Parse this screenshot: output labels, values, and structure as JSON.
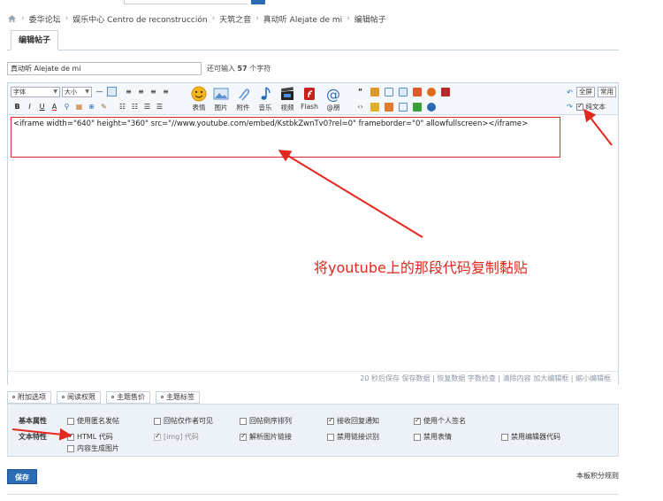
{
  "breadcrumb": [
    {
      "label": "委华论坛"
    },
    {
      "label": "娱乐中心 Centro de reconstrucción"
    },
    {
      "label": "天筑之音"
    },
    {
      "label": "真动听 Alejate de mi"
    },
    {
      "label": "编辑帖子"
    }
  ],
  "tabs": {
    "edit": "编辑帖子"
  },
  "title_input": {
    "value": "真动听 Alejate de mi"
  },
  "char_count": {
    "prefix": "还可输入",
    "count": "57",
    "suffix": "个字符"
  },
  "toolbar": {
    "font_select": "字体",
    "size_select": "大小",
    "bold": "B",
    "italic": "I",
    "underline": "U",
    "text_color": "A",
    "big_buttons": [
      "表情",
      "图片",
      "附件",
      "音乐",
      "视频",
      "Flash",
      "@朋"
    ],
    "fullscreen": "全屏",
    "common": "常用",
    "plain_text": "纯文本"
  },
  "editor": {
    "content": "<iframe width=\"640\" height=\"360\" src=\"//www.youtube.com/embed/KstbkZwnTv0?rel=0\" frameborder=\"0\" allowfullscreen></iframe>",
    "status": "20 秒后保存 保存数据 | 恢复数据     字数检查 | 清除内容     加大编辑框 | 缩小编辑框"
  },
  "annotation": "将youtube上的那段代码复制黏贴",
  "option_tabs": [
    "附加选项",
    "阅读权限",
    "主题售价",
    "主题标签"
  ],
  "options": {
    "basic_label": "基本属性",
    "text_label": "文本特性",
    "basic": [
      {
        "label": "使用匿名发帖",
        "checked": false
      },
      {
        "label": "回帖仅作者可见",
        "checked": false
      },
      {
        "label": "回帖倒序排列",
        "checked": false
      },
      {
        "label": "接收回复通知",
        "checked": true
      },
      {
        "label": "使用个人签名",
        "checked": true
      }
    ],
    "text": [
      {
        "label": "HTML 代码",
        "checked": true
      },
      {
        "label": "[img] 代码",
        "checked": true
      },
      {
        "label": "解析图片链接",
        "checked": true
      },
      {
        "label": "禁用链接识别",
        "checked": false
      },
      {
        "label": "禁用表情",
        "checked": false
      },
      {
        "label": "禁用编辑器代码",
        "checked": false
      }
    ],
    "extra": [
      {
        "label": "内容生成图片",
        "checked": false
      }
    ]
  },
  "save_button": "保存",
  "rule_link": "本板积分规则",
  "colors": {
    "accent": "#2b6cb5",
    "annotation": "#e3281e"
  }
}
